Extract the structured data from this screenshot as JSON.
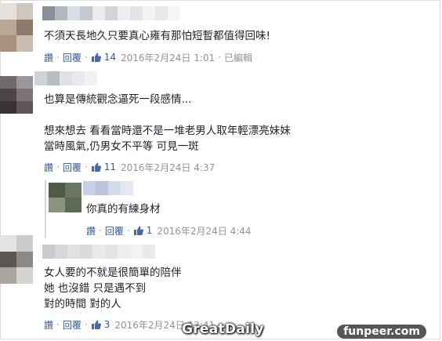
{
  "comments": [
    {
      "text_lines": [
        "不須天長地久只要真心雍有那怕短暫都值得回味!"
      ],
      "read_label": "讚",
      "reply_label": "回覆",
      "likes": "14",
      "time": "2016年2月24日 1:01",
      "edited_label": "已編輯"
    },
    {
      "text_lines": [
        "也算是傳統觀念逼死一段感情...",
        "",
        "想來想去 看看當時還不是一堆老男人取年輕漂亮妹妹",
        "當時風氣,仍男女不平等 可見一斑"
      ],
      "read_label": "讚",
      "reply_label": "回覆",
      "likes": "11",
      "time": "2016年2月24日 4:37"
    }
  ],
  "reply": {
    "text_lines": [
      "你真的有練身材"
    ],
    "read_label": "讚",
    "reply_label": "回覆",
    "likes": "1",
    "time": "2016年2月24日 4:44"
  },
  "last_comment": {
    "text_lines": [
      "女人要的不就是很簡單的陪伴",
      "她 也沒錯 只是遇不到",
      "對的時間 對的人"
    ],
    "read_label": "讚",
    "reply_label": "回覆",
    "likes": "3",
    "time": "2016年2月24日 13:41"
  },
  "watermarks": {
    "left": "GreatDaily",
    "right": "funpeer.com"
  },
  "colors": {
    "link": "#365899",
    "meta": "#90949c",
    "text": "#1d2129",
    "like_icon": "#4a67ad"
  }
}
